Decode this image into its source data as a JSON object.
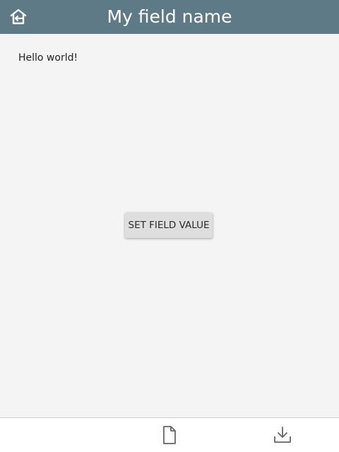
{
  "header": {
    "title": "My field name",
    "home_icon": "home-back-icon",
    "color": "#5f7a87"
  },
  "content": {
    "field_value": "Hello world!",
    "set_button_label": "SET FIELD VALUE"
  },
  "footer": {
    "icons": [
      "file-icon",
      "download-icon"
    ]
  }
}
